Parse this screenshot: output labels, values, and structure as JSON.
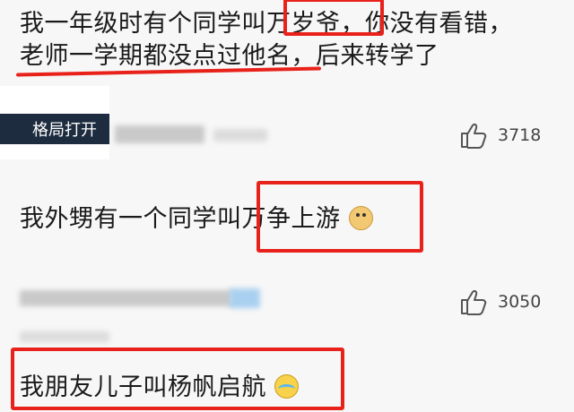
{
  "comments": [
    {
      "text_a": "我一年级时有个同学叫",
      "text_b": "万岁爷",
      "text_c": "，你没有看错，",
      "text_d": "老师一学期都没点过他名",
      "text_e": "，后来转学了"
    },
    {
      "badge_text": "格局打开",
      "likes": "3718",
      "text_a": "我外甥有一个同学叫",
      "text_b": "万争上游",
      "emoji": "doge-icon"
    },
    {
      "likes": "3050",
      "text_a": "我朋友儿子叫杨帆启航",
      "emoji": "laughing-crying-icon"
    }
  ],
  "colors": {
    "highlight": "#e8221b",
    "text": "#1a1a1a",
    "background": "#f7f7f7"
  }
}
